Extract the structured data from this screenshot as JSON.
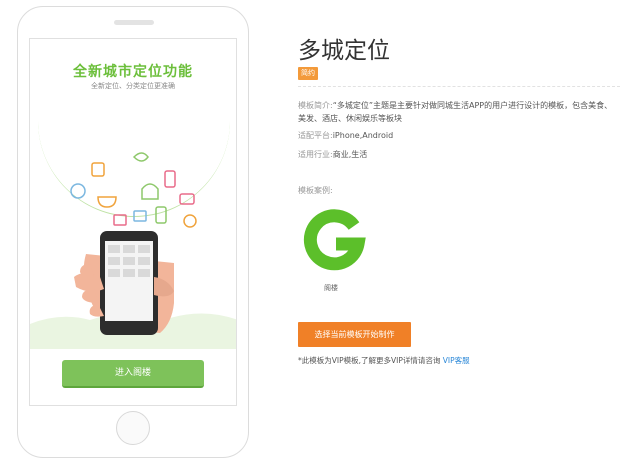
{
  "phone": {
    "screen_title": "全新城市定位功能",
    "screen_subtitle": "全新定位、分类定位更准确",
    "enter_button": "进入阁楼"
  },
  "detail": {
    "title": "多城定位",
    "tag": "简约",
    "desc_label": "模板简介:",
    "desc_text": "“多城定位”主题是主要针对做同城生活APP的用户进行设计的模板，包含美食、美发、酒店、休闲娱乐等板块",
    "platform_label": "适配平台:",
    "platform_value": "iPhone,Android",
    "industry_label": "适用行业:",
    "industry_value": "商业,生活",
    "example_label": "模板案例:",
    "example_name": "阁楼",
    "cta_button": "选择当前模板开始制作",
    "note_text": "*此模板为VIP模板,了解更多VIP详情请咨询 ",
    "note_link": "VIP客服"
  },
  "colors": {
    "green": "#7ec25a",
    "orange": "#f08027",
    "tag": "#f39a3a",
    "link": "#2b88d8"
  }
}
